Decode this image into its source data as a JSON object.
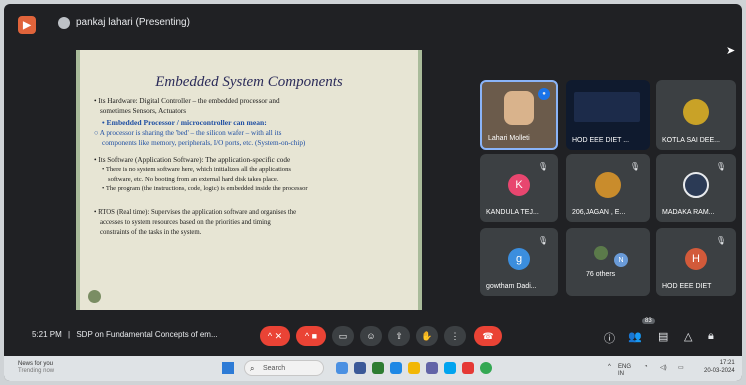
{
  "presenting": "pankaj lahari (Presenting)",
  "slide": {
    "title": "Embedded System Components",
    "lines": {
      "l1": "• Its Hardware: Digital Controller – the embedded processor and",
      "l2": "sometimes Sensors, Actuators",
      "l3": "• Embedded Processor / microcontroller can mean:",
      "l4": "○ A processor is sharing the 'bed' – the silicon wafer – with all its",
      "l5": "components like memory, peripherals, I/O ports, etc. (System-on-chip)",
      "l6": "• Its Software (Application Software): The application-specific code",
      "l7": "• There is no system software here, which initializes all the applications",
      "l8": "software, etc. No booting from an external hard disk takes place.",
      "l9": "• The program (the instructions, code, logic) is embedded inside the processor",
      "l10": "• RTOS (Real time): Supervises the application software and organises the",
      "l11": "accesses to system resources based on the priorities and timing",
      "l12": "constraints of the tasks in the system."
    }
  },
  "participants": [
    {
      "name": "Lahari Molleti",
      "initial": "",
      "color": "#1a73e8"
    },
    {
      "name": "HOD EEE DIET ...",
      "initial": "",
      "color": "#101828"
    },
    {
      "name": "KOTLA SAI DEE...",
      "initial": "",
      "color": "#c9a227"
    },
    {
      "name": "KANDULA TEJ...",
      "initial": "K",
      "color": "#e8466f"
    },
    {
      "name": "206,JAGAN , E...",
      "initial": "",
      "color": "#c98c2c"
    },
    {
      "name": "MADAKA RAM...",
      "initial": "",
      "color": "#2b3a55"
    },
    {
      "name": "gowtham Dadi...",
      "initial": "g",
      "color": "#3b8ede"
    },
    {
      "name": "76 others",
      "initial": "N",
      "color": "#6a9bd8"
    },
    {
      "name": "HOD EEE DIET",
      "initial": "H",
      "color": "#d25a3a"
    }
  ],
  "meeting": {
    "time": "5:21 PM",
    "separator": "|",
    "title": "SDP on Fundamental Concepts of em...",
    "participant_count": "83"
  },
  "taskbar": {
    "weather_line1": "News for you",
    "weather_line2": "Trending now",
    "search_placeholder": "Search",
    "lang": "ENG",
    "lang2": "IN",
    "time": "17:21",
    "date": "20-03-2024"
  },
  "colors": {
    "accent": "#ea4335",
    "bg": "#202124",
    "tile": "#3c4043"
  }
}
